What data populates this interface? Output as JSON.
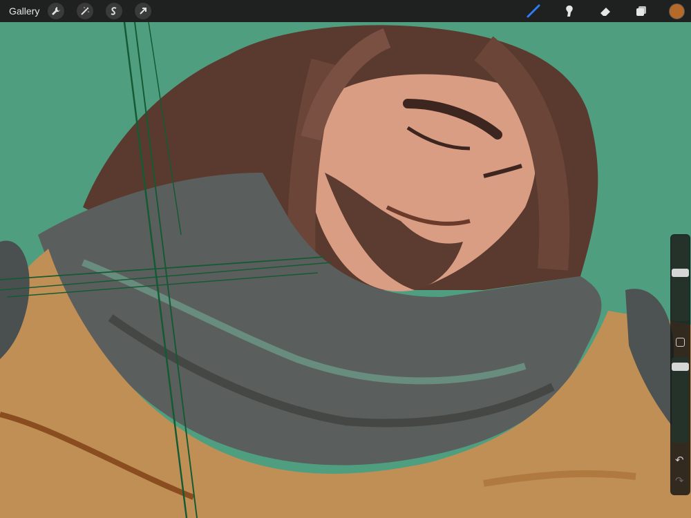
{
  "app": {
    "gallery_label": "Gallery",
    "left_tools": [
      "wrench-icon",
      "magic-wand-icon",
      "selection-icon",
      "transform-arrow-icon"
    ],
    "right_tools": [
      "brush-icon",
      "smudge-icon",
      "eraser-icon",
      "layers-icon"
    ],
    "active_tool": "brush-icon",
    "current_color": "#b66a2a",
    "accent_color": "#2f7df6"
  },
  "sidebar": {
    "brush_size": 0.43,
    "opacity": 0.62,
    "controls": [
      "brush-size-slider",
      "modify-button",
      "opacity-slider",
      "undo-icon",
      "redo-icon"
    ]
  }
}
